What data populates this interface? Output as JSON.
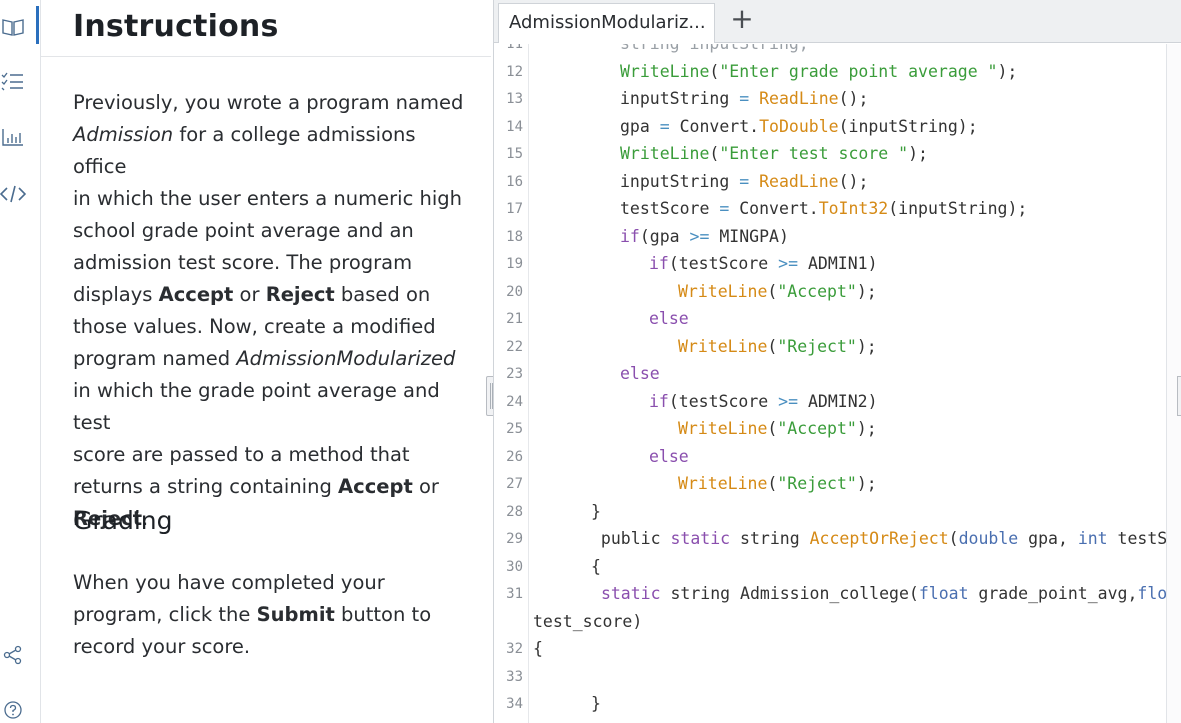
{
  "sidebar": {
    "icons": [
      "book-icon",
      "checklist-icon",
      "chart-icon",
      "code-icon",
      "share-icon",
      "help-icon"
    ]
  },
  "instructions": {
    "title": "Instructions",
    "lines": [
      [
        {
          "t": "Previously, you wrote a program named"
        }
      ],
      [
        {
          "t": "Admission",
          "s": "i"
        },
        {
          "t": " for a college admissions office"
        }
      ],
      [
        {
          "t": "in which the user enters a numeric high"
        }
      ],
      [
        {
          "t": "school grade point average and an"
        }
      ],
      [
        {
          "t": "admission test score. The program"
        }
      ],
      [
        {
          "t": "displays "
        },
        {
          "t": "Accept",
          "s": "b"
        },
        {
          "t": " or "
        },
        {
          "t": "Reject",
          "s": "b"
        },
        {
          "t": " based on"
        }
      ],
      [
        {
          "t": "those values. Now, create a modified"
        }
      ],
      [
        {
          "t": "program named "
        },
        {
          "t": "AdmissionModularized",
          "s": "i"
        }
      ],
      [
        {
          "t": "in which the grade point average and test"
        }
      ],
      [
        {
          "t": "score are passed to a method that"
        }
      ],
      [
        {
          "t": "returns a string containing "
        },
        {
          "t": "Accept",
          "s": "b"
        },
        {
          "t": " or"
        }
      ],
      [
        {
          "t": "Reject",
          "s": "b"
        },
        {
          "t": "."
        }
      ]
    ],
    "grading_heading": "Grading",
    "grading_lines": [
      [
        {
          "t": "When you have completed your"
        }
      ],
      [
        {
          "t": "program, click the "
        },
        {
          "t": "Submit",
          "s": "b"
        },
        {
          "t": " button to"
        }
      ],
      [
        {
          "t": "record your score."
        }
      ]
    ]
  },
  "editor": {
    "tab_label": "AdmissionModulariz...",
    "add_tab_symbol": "+",
    "code_lines": [
      {
        "n": "11",
        "ind": 3,
        "tokens": [
          {
            "t": "string inputString;"
          }
        ]
      },
      {
        "n": "12",
        "ind": 3,
        "tokens": [
          {
            "t": "WriteLine",
            "c": "#3a9c3a"
          },
          {
            "t": "(",
            "c": "#333333"
          },
          {
            "t": "\"Enter grade point average \"",
            "c": "#3a9c3a"
          },
          {
            "t": ");",
            "c": "#333333"
          }
        ]
      },
      {
        "n": "13",
        "ind": 3,
        "tokens": [
          {
            "t": "inputString ",
            "c": "#333333"
          },
          {
            "t": "=",
            "c": "#4a8fc0"
          },
          {
            "t": " ",
            "c": "#333333"
          },
          {
            "t": "ReadLine",
            "c": "#d58a16"
          },
          {
            "t": "();",
            "c": "#333333"
          }
        ]
      },
      {
        "n": "14",
        "ind": 3,
        "tokens": [
          {
            "t": "gpa ",
            "c": "#333333"
          },
          {
            "t": "=",
            "c": "#4a8fc0"
          },
          {
            "t": " Convert.",
            "c": "#333333"
          },
          {
            "t": "ToDouble",
            "c": "#d58a16"
          },
          {
            "t": "(inputString);",
            "c": "#333333"
          }
        ]
      },
      {
        "n": "15",
        "ind": 3,
        "tokens": [
          {
            "t": "WriteLine",
            "c": "#3a9c3a"
          },
          {
            "t": "(",
            "c": "#333333"
          },
          {
            "t": "\"Enter test score \"",
            "c": "#3a9c3a"
          },
          {
            "t": ");",
            "c": "#333333"
          }
        ]
      },
      {
        "n": "16",
        "ind": 3,
        "tokens": [
          {
            "t": "inputString ",
            "c": "#333333"
          },
          {
            "t": "=",
            "c": "#4a8fc0"
          },
          {
            "t": " ",
            "c": "#333333"
          },
          {
            "t": "ReadLine",
            "c": "#d58a16"
          },
          {
            "t": "();",
            "c": "#333333"
          }
        ]
      },
      {
        "n": "17",
        "ind": 3,
        "tokens": [
          {
            "t": "testScore ",
            "c": "#333333"
          },
          {
            "t": "=",
            "c": "#4a8fc0"
          },
          {
            "t": " Convert.",
            "c": "#333333"
          },
          {
            "t": "ToInt32",
            "c": "#d58a16"
          },
          {
            "t": "(inputString);",
            "c": "#333333"
          }
        ]
      },
      {
        "n": "18",
        "ind": 3,
        "tokens": [
          {
            "t": "if",
            "c": "#8a4fae"
          },
          {
            "t": "(gpa ",
            "c": "#333333"
          },
          {
            "t": ">=",
            "c": "#4a8fc0"
          },
          {
            "t": " MINGPA)",
            "c": "#333333"
          }
        ]
      },
      {
        "n": "19",
        "ind": 4,
        "tokens": [
          {
            "t": "if",
            "c": "#8a4fae"
          },
          {
            "t": "(testScore ",
            "c": "#333333"
          },
          {
            "t": ">=",
            "c": "#4a8fc0"
          },
          {
            "t": " ADMIN1)",
            "c": "#333333"
          }
        ]
      },
      {
        "n": "20",
        "ind": 5,
        "tokens": [
          {
            "t": "WriteLine",
            "c": "#d58a16"
          },
          {
            "t": "(",
            "c": "#333333"
          },
          {
            "t": "\"Accept\"",
            "c": "#3a9c3a"
          },
          {
            "t": ");",
            "c": "#333333"
          }
        ]
      },
      {
        "n": "21",
        "ind": 4,
        "tokens": [
          {
            "t": "else",
            "c": "#8a4fae"
          }
        ]
      },
      {
        "n": "22",
        "ind": 5,
        "tokens": [
          {
            "t": "WriteLine",
            "c": "#d58a16"
          },
          {
            "t": "(",
            "c": "#333333"
          },
          {
            "t": "\"Reject\"",
            "c": "#3a9c3a"
          },
          {
            "t": ");",
            "c": "#333333"
          }
        ]
      },
      {
        "n": "23",
        "ind": 3,
        "tokens": [
          {
            "t": "else",
            "c": "#8a4fae"
          }
        ]
      },
      {
        "n": "24",
        "ind": 4,
        "tokens": [
          {
            "t": "if",
            "c": "#8a4fae"
          },
          {
            "t": "(testScore ",
            "c": "#333333"
          },
          {
            "t": ">=",
            "c": "#4a8fc0"
          },
          {
            "t": " ADMIN2)",
            "c": "#333333"
          }
        ]
      },
      {
        "n": "25",
        "ind": 5,
        "tokens": [
          {
            "t": "WriteLine",
            "c": "#d58a16"
          },
          {
            "t": "(",
            "c": "#333333"
          },
          {
            "t": "\"Accept\"",
            "c": "#3a9c3a"
          },
          {
            "t": ");",
            "c": "#333333"
          }
        ]
      },
      {
        "n": "26",
        "ind": 4,
        "tokens": [
          {
            "t": "else",
            "c": "#8a4fae"
          }
        ]
      },
      {
        "n": "27",
        "ind": 5,
        "tokens": [
          {
            "t": "WriteLine",
            "c": "#d58a16"
          },
          {
            "t": "(",
            "c": "#333333"
          },
          {
            "t": "\"Reject\"",
            "c": "#3a9c3a"
          },
          {
            "t": ");",
            "c": "#333333"
          }
        ]
      },
      {
        "n": "28",
        "ind": 2,
        "tokens": [
          {
            "t": "}",
            "c": "#333333"
          }
        ]
      },
      {
        "n": "29",
        "ind": 2,
        "tokens": [
          {
            "t": " public ",
            "c": "#333333"
          },
          {
            "t": "static",
            "c": "#8a4fae"
          },
          {
            "t": " string ",
            "c": "#333333"
          },
          {
            "t": "AcceptOrReject",
            "c": "#d58a16"
          },
          {
            "t": "(",
            "c": "#333333"
          },
          {
            "t": "double",
            "c": "#4a6fb0"
          },
          {
            "t": " gpa, ",
            "c": "#333333"
          },
          {
            "t": "int",
            "c": "#4a6fb0"
          },
          {
            "t": " testScore)",
            "c": "#333333"
          }
        ]
      },
      {
        "n": "30",
        "ind": 2,
        "tokens": [
          {
            "t": "{",
            "c": "#333333"
          }
        ]
      },
      {
        "n": "31",
        "ind": 2,
        "tokens": [
          {
            "t": " ",
            "c": "#333333"
          },
          {
            "t": "static",
            "c": "#8a4fae"
          },
          {
            "t": " string Admission_college(",
            "c": "#333333"
          },
          {
            "t": "float",
            "c": "#4a6fb0"
          },
          {
            "t": " grade_point_avg,",
            "c": "#333333"
          },
          {
            "t": "float",
            "c": "#4a6fb0"
          }
        ]
      },
      {
        "n": "",
        "ind": 0,
        "tokens": [
          {
            "t": "test_score)",
            "c": "#333333"
          }
        ]
      },
      {
        "n": "32",
        "ind": 0,
        "tokens": [
          {
            "t": "{",
            "c": "#333333"
          }
        ]
      },
      {
        "n": "33",
        "ind": 0,
        "tokens": []
      },
      {
        "n": "34",
        "ind": 2,
        "tokens": [
          {
            "t": "}",
            "c": "#333333"
          }
        ]
      }
    ]
  }
}
